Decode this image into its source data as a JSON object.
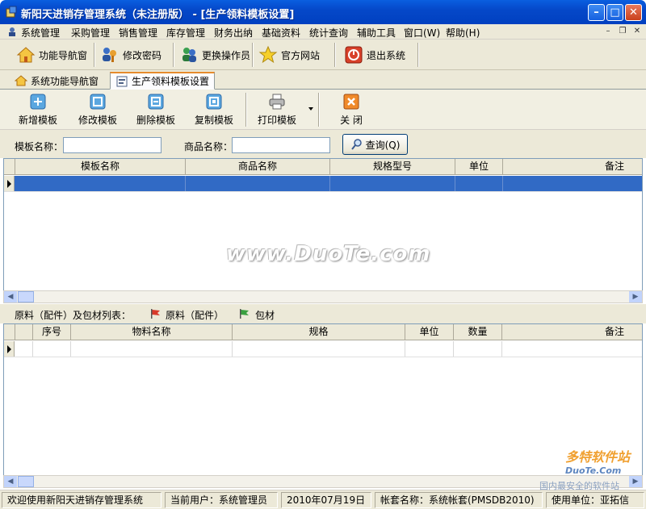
{
  "window": {
    "title": "新阳天进销存管理系统（未注册版） - [生产领料模板设置]",
    "minimize": "–",
    "maximize": "□",
    "close": "✕"
  },
  "menubar": {
    "items": [
      "系统管理",
      "采购管理",
      "销售管理",
      "库存管理",
      "财务出纳",
      "基础资料",
      "统计查询",
      "辅助工具",
      "窗口(W)",
      "帮助(H)"
    ],
    "mdi_minimize": "–",
    "mdi_restore": "❐",
    "mdi_close": "✕"
  },
  "toolbar": {
    "items": [
      {
        "label": "功能导航窗",
        "icon": "home-icon"
      },
      {
        "label": "修改密码",
        "icon": "users-key-icon"
      },
      {
        "label": "更换操作员",
        "icon": "switch-user-icon"
      },
      {
        "label": "官方网站",
        "icon": "star-icon"
      },
      {
        "label": "退出系统",
        "icon": "exit-icon"
      }
    ]
  },
  "tabs": [
    {
      "label": "系统功能导航窗",
      "icon": "home-icon",
      "active": false
    },
    {
      "label": "生产领料模板设置",
      "icon": "form-icon",
      "active": true
    }
  ],
  "actions": {
    "add": "新增模板",
    "edit": "修改模板",
    "delete": "删除模板",
    "copy": "复制模板",
    "print": "打印模板",
    "close": "关 闭"
  },
  "search": {
    "template_name_label": "模板名称：",
    "template_name_value": "",
    "product_name_label": "商品名称：",
    "product_name_value": "",
    "query_button": "查询(Q)"
  },
  "template_grid": {
    "columns": [
      "模板名称",
      "商品名称",
      "规格型号",
      "单位",
      "备注"
    ],
    "rows": [
      [
        "",
        "",
        "",
        "",
        ""
      ]
    ]
  },
  "material_section": {
    "label": "原料（配件）及包材列表：",
    "raw_label": "原料（配件）",
    "pack_label": "包材",
    "raw_color": "#d83a2a",
    "pack_color": "#3aa040"
  },
  "material_grid": {
    "columns": [
      "序号",
      "物料名称",
      "规格",
      "单位",
      "数量",
      "备注"
    ],
    "rows": [
      [
        "",
        "",
        "",
        "",
        "",
        ""
      ]
    ]
  },
  "status": {
    "welcome": "欢迎使用新阳天进销存管理系统",
    "user": "当前用户：系统管理员",
    "date": "2010年07月19日",
    "account": "帐套名称：系统帐套(PMSDB2010)",
    "unit": "使用单位：亚拓信"
  },
  "watermarks": {
    "center": "www.DuoTe.com",
    "brand": "多特软件站",
    "brand_url": "DuoTe.Com",
    "slogan": "国内最安全的软件站"
  },
  "colors": {
    "title_blue": "#0548c9",
    "selected_row": "#316ac5"
  }
}
